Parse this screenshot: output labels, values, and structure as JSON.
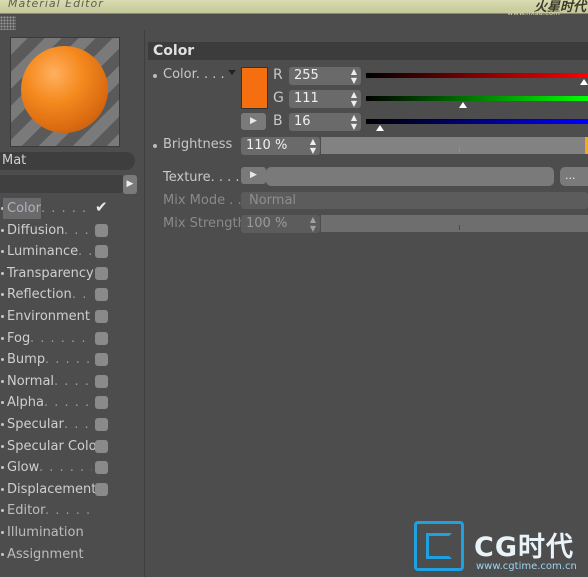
{
  "window": {
    "title": "Material Editor",
    "watermark": "火星时代",
    "watermark_url": "www.hxsd.com"
  },
  "material": {
    "name": "Mat",
    "preview_color": "#f58a1f"
  },
  "channels": [
    {
      "label": "Color",
      "dots": " . . . . .",
      "checked": true,
      "has_check": true,
      "selected": true
    },
    {
      "label": "Diffusion",
      "dots": ". . . .",
      "checked": false,
      "has_check": true
    },
    {
      "label": "Luminance",
      "dots": ". . . .",
      "checked": false,
      "has_check": true
    },
    {
      "label": "Transparency",
      "dots": "",
      "checked": false,
      "has_check": true
    },
    {
      "label": "Reflection",
      "dots": ". . . .",
      "checked": false,
      "has_check": true
    },
    {
      "label": "Environment",
      "dots": "",
      "checked": false,
      "has_check": true
    },
    {
      "label": "Fog",
      "dots": ". . . . . . . . .",
      "checked": false,
      "has_check": true
    },
    {
      "label": "Bump",
      "dots": ". . . . . . . .",
      "checked": false,
      "has_check": true
    },
    {
      "label": "Normal",
      "dots": ". . . . . . .",
      "checked": false,
      "has_check": true
    },
    {
      "label": "Alpha",
      "dots": ". . . . . . . .",
      "checked": false,
      "has_check": true
    },
    {
      "label": "Specular",
      "dots": ". . . . . .",
      "checked": false,
      "has_check": true
    },
    {
      "label": "Specular Color",
      "dots": "",
      "checked": false,
      "has_check": true
    },
    {
      "label": "Glow",
      "dots": ". . . . . . . . .",
      "checked": false,
      "has_check": true
    },
    {
      "label": "Displacement",
      "dots": "",
      "checked": false,
      "has_check": true
    },
    {
      "label": "Editor",
      "dots": ". . . . . . . .",
      "checked": false,
      "has_check": false
    },
    {
      "label": "Illumination",
      "dots": "",
      "checked": false,
      "has_check": false
    },
    {
      "label": "Assignment",
      "dots": "",
      "checked": false,
      "has_check": false
    }
  ],
  "color_section": {
    "header": "Color",
    "color_label": "Color. . . .",
    "swatch_color": "#f56f10",
    "r_label": "R",
    "r_value": "255",
    "g_label": "G",
    "g_value": "111",
    "b_label": "B",
    "b_value": "16",
    "r_level": 1.0,
    "g_level": 0.435,
    "b_level": 0.063,
    "brightness_label": "Brightness",
    "brightness_value": "110 %",
    "brightness_level": 1.1,
    "texture_label": "Texture. . . .",
    "texture_more": "...",
    "mix_mode_label": "Mix Mode . .",
    "mix_mode_value": "Normal",
    "mix_strength_label": "Mix Strength",
    "mix_strength_value": "100 %",
    "mix_strength_level": 1.0
  },
  "footer_logo": {
    "brand": "CG时代",
    "url": "www.cgtime.com.cn"
  },
  "colors": {
    "accent_orange": "#f56f10",
    "panel_bg": "#4d4d4d",
    "logo_blue": "#1fa0e0"
  }
}
